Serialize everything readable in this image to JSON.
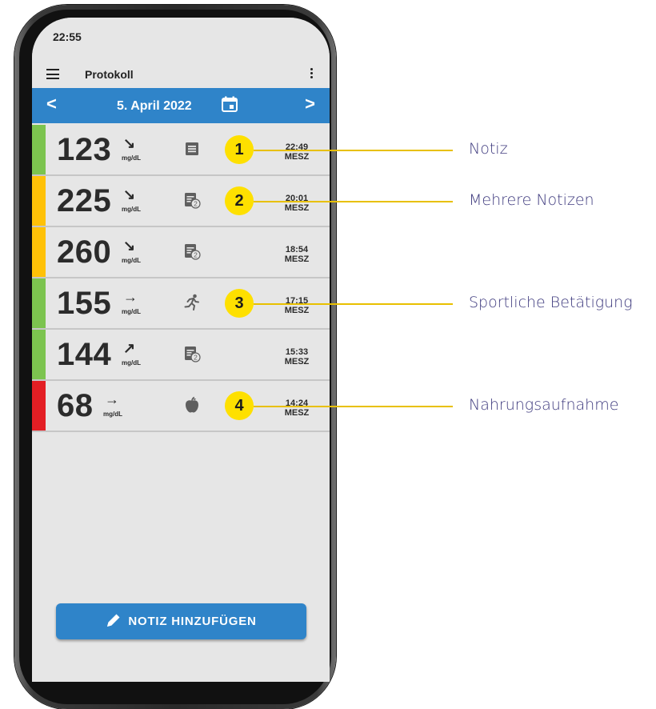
{
  "status_bar": {
    "time": "22:55"
  },
  "app_bar": {
    "title": "Protokoll"
  },
  "date_bar": {
    "date": "5. April 2022",
    "prev": "<",
    "next": ">"
  },
  "entries": [
    {
      "value": "123",
      "trend": "↘",
      "unit": "mg/dL",
      "time": "22:49",
      "tz": "MESZ",
      "range_color": "#7cc44f",
      "icon": "note-icon",
      "callout": "1"
    },
    {
      "value": "225",
      "trend": "↘",
      "unit": "mg/dL",
      "time": "20:01",
      "tz": "MESZ",
      "range_color": "#ffc107",
      "icon": "multiple-notes-icon",
      "callout": "2"
    },
    {
      "value": "260",
      "trend": "↘",
      "unit": "mg/dL",
      "time": "18:54",
      "tz": "MESZ",
      "range_color": "#ffc107",
      "icon": "multiple-notes-icon",
      "callout": ""
    },
    {
      "value": "155",
      "trend": "→",
      "unit": "mg/dL",
      "time": "17:15",
      "tz": "MESZ",
      "range_color": "#7cc44f",
      "icon": "exercise-icon",
      "callout": "3"
    },
    {
      "value": "144",
      "trend": "↗",
      "unit": "mg/dL",
      "time": "15:33",
      "tz": "MESZ",
      "range_color": "#7cc44f",
      "icon": "multiple-notes-icon",
      "callout": ""
    },
    {
      "value": "68",
      "trend": "→",
      "unit": "mg/dL",
      "time": "14:24",
      "tz": "MESZ",
      "range_color": "#e31e24",
      "icon": "food-icon",
      "callout": "4"
    }
  ],
  "add_note_button": {
    "label": "NOTIZ HINZUFÜGEN"
  },
  "annotations": [
    {
      "label": "Notiz"
    },
    {
      "label": "Mehrere Notizen"
    },
    {
      "label": "Sportliche Betätigung"
    },
    {
      "label": "Nahrungsaufnahme"
    }
  ],
  "colors": {
    "accent": "#2f84c9",
    "callout": "#fee000",
    "annotation_text": "#3e3a7e"
  }
}
